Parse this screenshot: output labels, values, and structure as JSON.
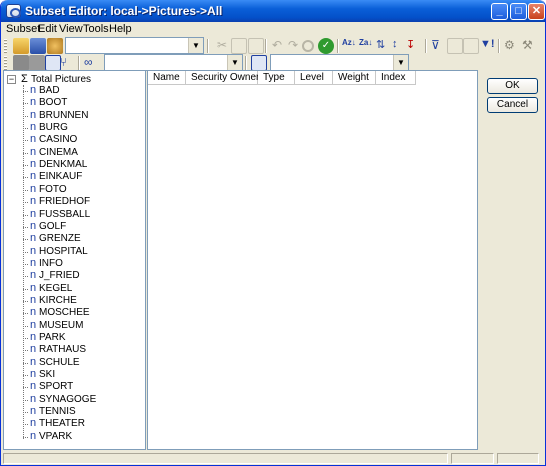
{
  "window": {
    "title": "Subset Editor:  local->Pictures->All",
    "controls": [
      "minimize",
      "maximize",
      "close"
    ]
  },
  "menu": {
    "items": [
      "Subset",
      "Edit",
      "View",
      "Tools",
      "Help"
    ]
  },
  "toolbar1": {
    "combo_value": "",
    "icons": [
      "new-subset-icon",
      "save-icon",
      "save-as-icon",
      "cut-icon",
      "copy-icon",
      "paste-icon",
      "undo-icon",
      "redo-icon",
      "cancel-icon",
      "ok-check-icon",
      "sort-asc-icon",
      "sort-desc-icon",
      "sort-hierarchy-asc-icon",
      "sort-hierarchy-desc-icon",
      "filter-icon",
      "filter-list-icon",
      "filter-clear-icon",
      "filter-attribute-icon",
      "settings-icon",
      "tools-icon"
    ]
  },
  "toolbar2": {
    "combo1_value": "",
    "combo2_value": ""
  },
  "grid": {
    "columns": [
      "Name",
      "Security Owner",
      "Type",
      "Level",
      "Weight",
      "Index"
    ]
  },
  "tree": {
    "root": "Total Pictures",
    "items": [
      "BAD",
      "BOOT",
      "BRUNNEN",
      "BURG",
      "CASINO",
      "CINEMA",
      "DENKMAL",
      "EINKAUF",
      "FOTO",
      "FRIEDHOF",
      "FUSSBALL",
      "GOLF",
      "GRENZE",
      "HOSPITAL",
      "INFO",
      "J_FRIED",
      "KEGEL",
      "KIRCHE",
      "MOSCHEE",
      "MUSEUM",
      "PARK",
      "RATHAUS",
      "SCHULE",
      "SKI",
      "SPORT",
      "SYNAGOGE",
      "TENNIS",
      "THEATER",
      "VPARK"
    ],
    "item_marker": "n"
  },
  "buttons": {
    "ok": "OK",
    "cancel": "Cancel"
  },
  "colors": {
    "titlebar": "#0a5fd8",
    "window_bg": "#ece9d8",
    "pane_border": "#7f9db9"
  }
}
